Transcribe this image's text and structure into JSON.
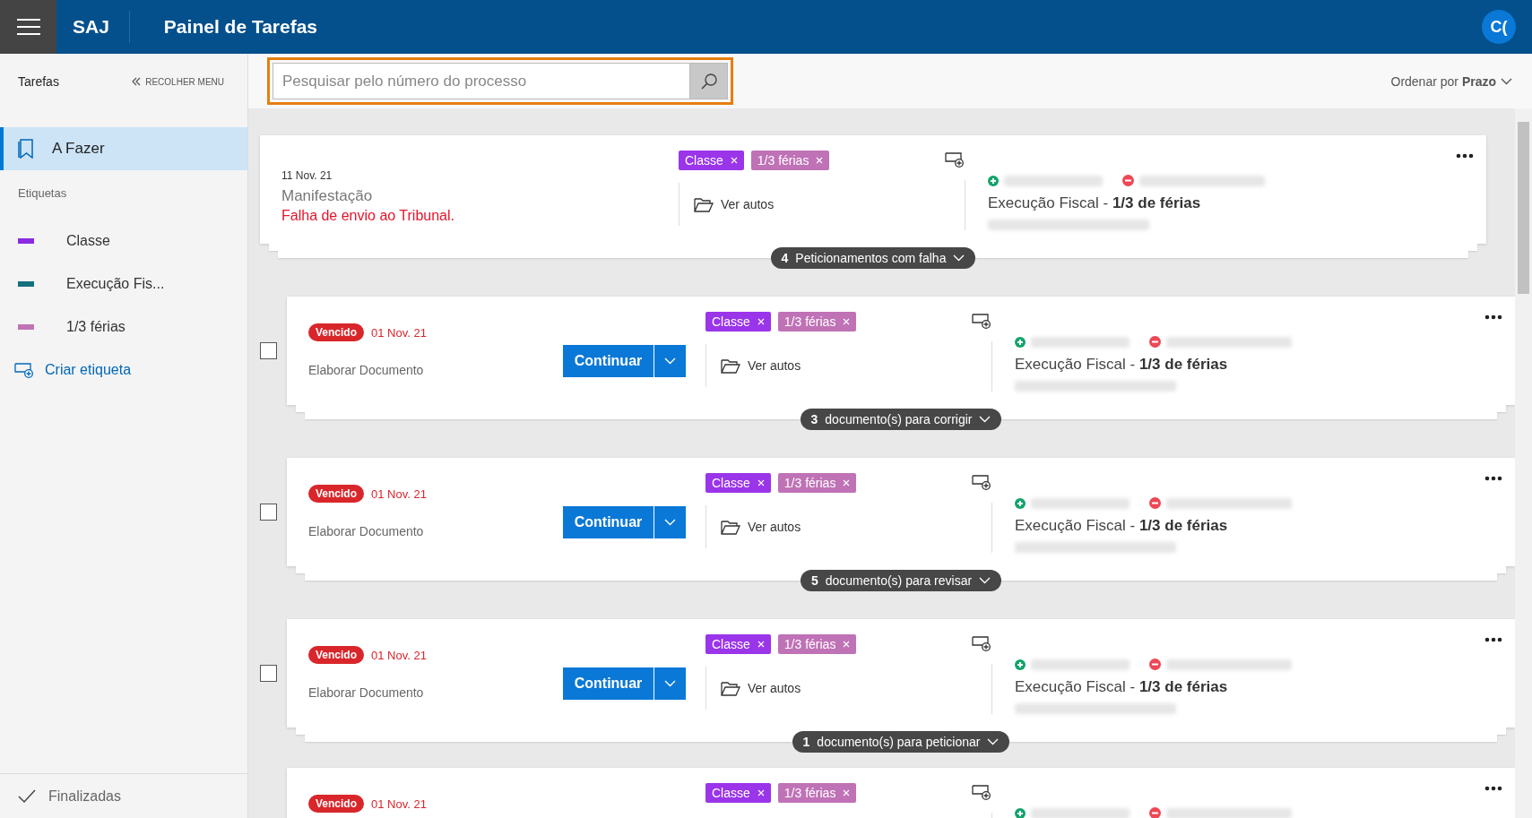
{
  "header": {
    "logo": "SAJ",
    "title": "Painel de Tarefas",
    "avatar": "C("
  },
  "sidebar": {
    "title": "Tarefas",
    "collapse": "RECOLHER MENU",
    "items": [
      {
        "label": "A Fazer",
        "selected": true
      }
    ],
    "labels_heading": "Etiquetas",
    "labels": [
      {
        "name": "Classe",
        "color": "#8a2be2"
      },
      {
        "name": "Execução Fis...",
        "color": "#14707e"
      },
      {
        "name": "1/3 férias",
        "color": "#c074b6"
      }
    ],
    "create_label": "Criar etiqueta",
    "footer": "Finalizadas"
  },
  "toolbar": {
    "search": {
      "placeholder": "Pesquisar pelo número do processo"
    },
    "sort_label": "Ordenar por",
    "sort_value": "Prazo"
  },
  "cards": [
    {
      "kind": "failed",
      "date": "11 Nov. 21",
      "title": "Manifestação",
      "error": "Falha de envio ao Tribunal.",
      "tags": [
        {
          "label": "Classe",
          "color": "#9a35ea"
        },
        {
          "label": "1/3 férias",
          "color": "#bf72b6"
        }
      ],
      "link": "Ver autos",
      "case": "Execução Fiscal - **1/3 de férias**",
      "group": "**4** Peticionamentos com falha"
    },
    {
      "kind": "task",
      "checked": false,
      "status": "Vencido",
      "date": "01 Nov. 21",
      "task": "Elaborar Documento",
      "button": "Continuar",
      "tags": [
        {
          "label": "Classe",
          "color": "#9a35ea"
        },
        {
          "label": "1/3 férias",
          "color": "#bf72b6"
        }
      ],
      "link": "Ver autos",
      "case": "Execução Fiscal - **1/3 de férias**",
      "group": "**3** documento(s) para corrigir"
    },
    {
      "kind": "task",
      "checked": false,
      "status": "Vencido",
      "date": "01 Nov. 21",
      "task": "Elaborar Documento",
      "button": "Continuar",
      "tags": [
        {
          "label": "Classe",
          "color": "#9a35ea"
        },
        {
          "label": "1/3 férias",
          "color": "#bf72b6"
        }
      ],
      "link": "Ver autos",
      "case": "Execução Fiscal - **1/3 de férias**",
      "group": "**5** documento(s) para revisar"
    },
    {
      "kind": "task",
      "checked": false,
      "status": "Vencido",
      "date": "01 Nov. 21",
      "task": "Elaborar Documento",
      "button": "Continuar",
      "tags": [
        {
          "label": "Classe",
          "color": "#9a35ea"
        },
        {
          "label": "1/3 férias",
          "color": "#bf72b6"
        }
      ],
      "link": "Ver autos",
      "case": "Execução Fiscal - **1/3 de férias**",
      "group": "**1** documento(s) para peticionar"
    },
    {
      "kind": "task",
      "status": "Vencido",
      "date": "01 Nov. 21",
      "tags": [
        {
          "label": "Classe",
          "color": "#9a35ea"
        },
        {
          "label": "1/3 férias",
          "color": "#bf72b6"
        }
      ]
    }
  ]
}
